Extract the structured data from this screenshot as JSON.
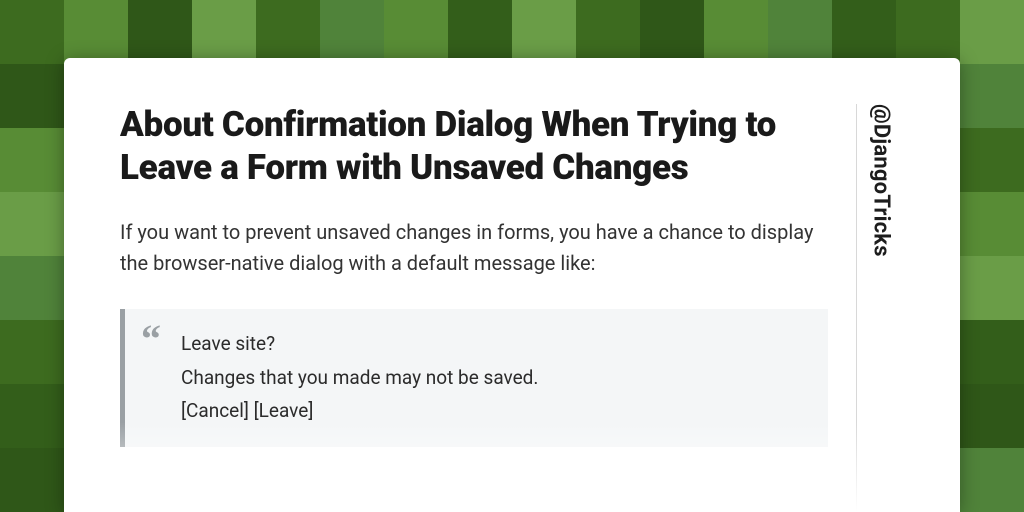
{
  "title": "About Confirmation Dialog When Trying to Leave a Form with Unsaved Changes",
  "intro": "If you want to prevent unsaved changes in forms, you have a chance to display the browser-native dialog with a default message like:",
  "quote": {
    "line1": "Leave site?",
    "line2": "Changes that you made may not be saved.",
    "line3": "[Cancel] [Leave]"
  },
  "handle": "@DjangoTricks"
}
